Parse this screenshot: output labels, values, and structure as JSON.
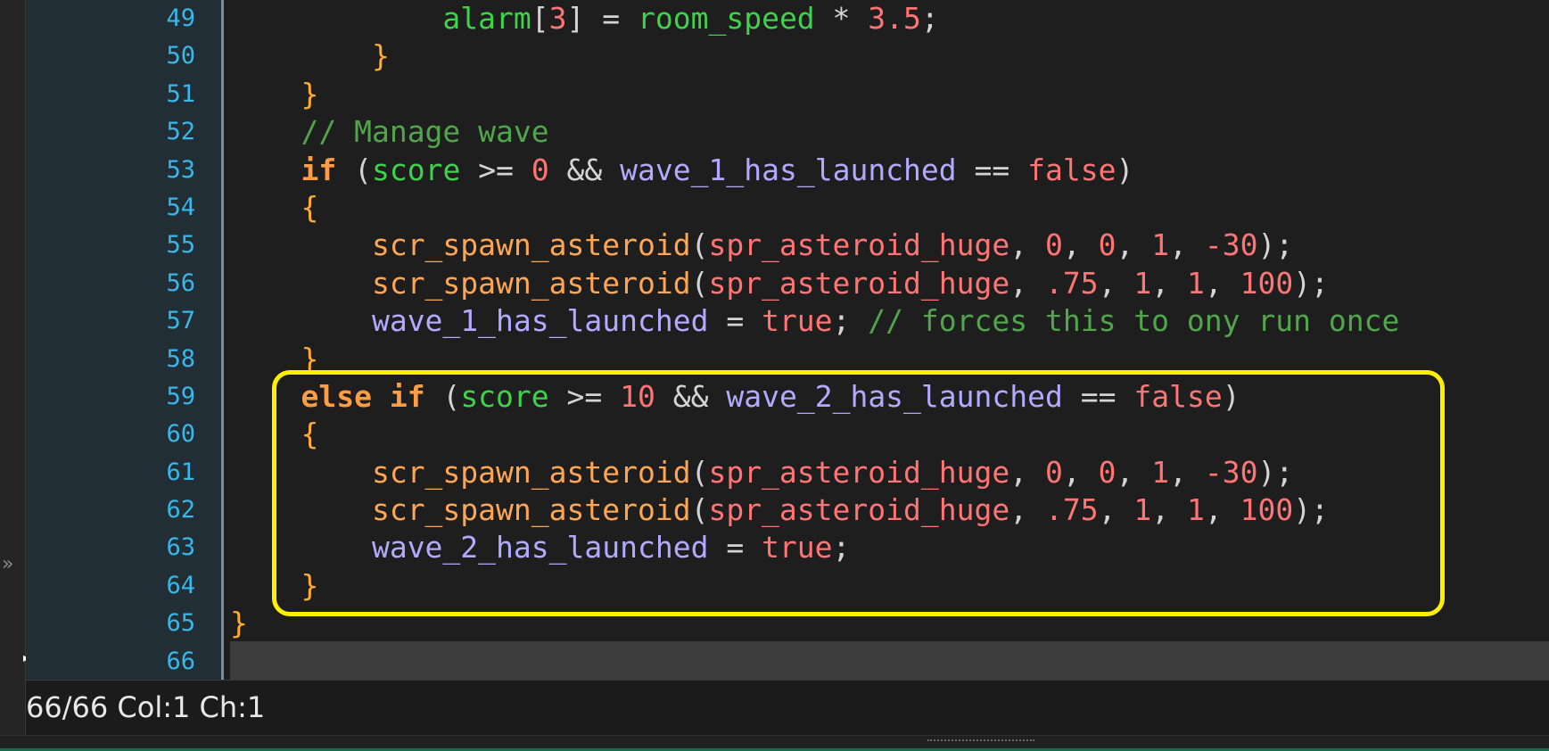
{
  "sidebar": {
    "collapse_glyph": "»",
    "caret_glyph": "▸"
  },
  "editor": {
    "line_numbers": [
      "49",
      "50",
      "51",
      "52",
      "53",
      "54",
      "55",
      "56",
      "57",
      "58",
      "59",
      "60",
      "61",
      "62",
      "63",
      "64",
      "65",
      "66"
    ],
    "current_line": "66",
    "highlight_box_lines": [
      "59",
      "64"
    ],
    "lines": [
      [
        [
          "p",
          "            "
        ],
        [
          "bi",
          "alarm"
        ],
        [
          "p",
          "["
        ],
        [
          "n",
          "3"
        ],
        [
          "p",
          "] = "
        ],
        [
          "bi",
          "room_speed"
        ],
        [
          "p",
          " * "
        ],
        [
          "n",
          "3.5"
        ],
        [
          "p",
          ";"
        ]
      ],
      [
        [
          "p",
          "        "
        ],
        [
          "br",
          "}"
        ]
      ],
      [
        [
          "p",
          "    "
        ],
        [
          "br",
          "}"
        ]
      ],
      [
        [
          "p",
          "    "
        ],
        [
          "c",
          "// Manage wave"
        ]
      ],
      [
        [
          "p",
          "    "
        ],
        [
          "k",
          "if"
        ],
        [
          "p",
          " ("
        ],
        [
          "bi",
          "score"
        ],
        [
          "p",
          " >= "
        ],
        [
          "n",
          "0"
        ],
        [
          "p",
          " && "
        ],
        [
          "v",
          "wave_1_has_launched"
        ],
        [
          "p",
          " == "
        ],
        [
          "n",
          "false"
        ],
        [
          "p",
          ")"
        ]
      ],
      [
        [
          "p",
          "    "
        ],
        [
          "br",
          "{"
        ]
      ],
      [
        [
          "p",
          "        "
        ],
        [
          "fn",
          "scr_spawn_asteroid"
        ],
        [
          "p",
          "("
        ],
        [
          "n",
          "spr_asteroid_huge"
        ],
        [
          "p",
          ", "
        ],
        [
          "n",
          "0"
        ],
        [
          "p",
          ", "
        ],
        [
          "n",
          "0"
        ],
        [
          "p",
          ", "
        ],
        [
          "n",
          "1"
        ],
        [
          "p",
          ", "
        ],
        [
          "n",
          "-30"
        ],
        [
          "p",
          ");"
        ]
      ],
      [
        [
          "p",
          "        "
        ],
        [
          "fn",
          "scr_spawn_asteroid"
        ],
        [
          "p",
          "("
        ],
        [
          "n",
          "spr_asteroid_huge"
        ],
        [
          "p",
          ", "
        ],
        [
          "n",
          ".75"
        ],
        [
          "p",
          ", "
        ],
        [
          "n",
          "1"
        ],
        [
          "p",
          ", "
        ],
        [
          "n",
          "1"
        ],
        [
          "p",
          ", "
        ],
        [
          "n",
          "100"
        ],
        [
          "p",
          ");"
        ]
      ],
      [
        [
          "p",
          "        "
        ],
        [
          "v",
          "wave_1_has_launched"
        ],
        [
          "p",
          " = "
        ],
        [
          "n",
          "true"
        ],
        [
          "p",
          "; "
        ],
        [
          "c",
          "// forces this to ony run once"
        ]
      ],
      [
        [
          "p",
          "    "
        ],
        [
          "br",
          "}"
        ]
      ],
      [
        [
          "p",
          "    "
        ],
        [
          "k",
          "else if"
        ],
        [
          "p",
          " ("
        ],
        [
          "bi",
          "score"
        ],
        [
          "p",
          " >= "
        ],
        [
          "n",
          "10"
        ],
        [
          "p",
          " && "
        ],
        [
          "v",
          "wave_2_has_launched"
        ],
        [
          "p",
          " == "
        ],
        [
          "n",
          "false"
        ],
        [
          "p",
          ")"
        ]
      ],
      [
        [
          "p",
          "    "
        ],
        [
          "br",
          "{"
        ]
      ],
      [
        [
          "p",
          "        "
        ],
        [
          "fn",
          "scr_spawn_asteroid"
        ],
        [
          "p",
          "("
        ],
        [
          "n",
          "spr_asteroid_huge"
        ],
        [
          "p",
          ", "
        ],
        [
          "n",
          "0"
        ],
        [
          "p",
          ", "
        ],
        [
          "n",
          "0"
        ],
        [
          "p",
          ", "
        ],
        [
          "n",
          "1"
        ],
        [
          "p",
          ", "
        ],
        [
          "n",
          "-30"
        ],
        [
          "p",
          ");"
        ]
      ],
      [
        [
          "p",
          "        "
        ],
        [
          "fn",
          "scr_spawn_asteroid"
        ],
        [
          "p",
          "("
        ],
        [
          "n",
          "spr_asteroid_huge"
        ],
        [
          "p",
          ", "
        ],
        [
          "n",
          ".75"
        ],
        [
          "p",
          ", "
        ],
        [
          "n",
          "1"
        ],
        [
          "p",
          ", "
        ],
        [
          "n",
          "1"
        ],
        [
          "p",
          ", "
        ],
        [
          "n",
          "100"
        ],
        [
          "p",
          ");"
        ]
      ],
      [
        [
          "p",
          "        "
        ],
        [
          "v",
          "wave_2_has_launched"
        ],
        [
          "p",
          " = "
        ],
        [
          "n",
          "true"
        ],
        [
          "p",
          ";"
        ]
      ],
      [
        [
          "p",
          "    "
        ],
        [
          "br",
          "}"
        ]
      ],
      [
        [
          "br",
          "}"
        ]
      ],
      []
    ]
  },
  "status_bar": {
    "position_text": "66/66 Col:1 Ch:1"
  },
  "colors": {
    "highlight_box": "#ffef00",
    "line_number": "#38b7e8",
    "keyword": "#ff9d45",
    "function": "#ffa655",
    "variable": "#b4a8ff",
    "builtin": "#3ed34a",
    "literal": "#ff7474",
    "comment": "#51a54b"
  }
}
